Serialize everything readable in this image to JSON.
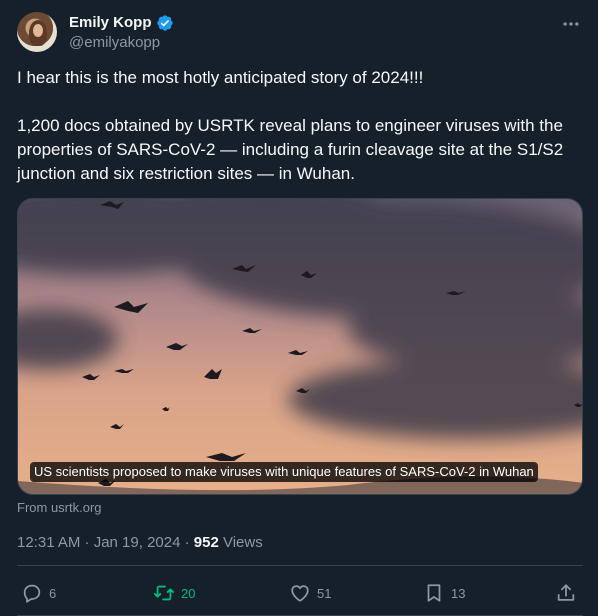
{
  "author": {
    "display_name": "Emily Kopp",
    "handle": "@emilyakopp",
    "verified": true
  },
  "tweet": {
    "paragraphs": [
      "I hear this is the most hotly anticipated story of 2024!!!",
      "1,200 docs obtained by USRTK reveal plans to engineer viruses with the properties of SARS-CoV-2 — including a furin cleavage site at the S1/S2 junction and six restriction sites — in Wuhan."
    ]
  },
  "card": {
    "caption": "US scientists proposed to make viruses with unique features of SARS-CoV-2 in Wuhan",
    "source": "From usrtk.org"
  },
  "meta": {
    "timestamp": "12:31 AM · Jan 19, 2024",
    "separator": " · ",
    "views_count": "952",
    "views_label": " Views"
  },
  "actions": {
    "replies": "6",
    "retweets": "20",
    "likes": "51",
    "bookmarks": "13"
  },
  "icons": {
    "verified": "verified-badge-icon",
    "more": "more-dots-icon",
    "reply": "reply-icon",
    "retweet": "retweet-icon",
    "like": "heart-icon",
    "bookmark": "bookmark-icon",
    "share": "share-icon"
  },
  "colors": {
    "background": "#15202b",
    "text": "#f7f9f9",
    "secondary": "#8b98a5",
    "accent": "#1d9bf0",
    "retweet_active": "#00ba7c",
    "border": "#38444d"
  }
}
